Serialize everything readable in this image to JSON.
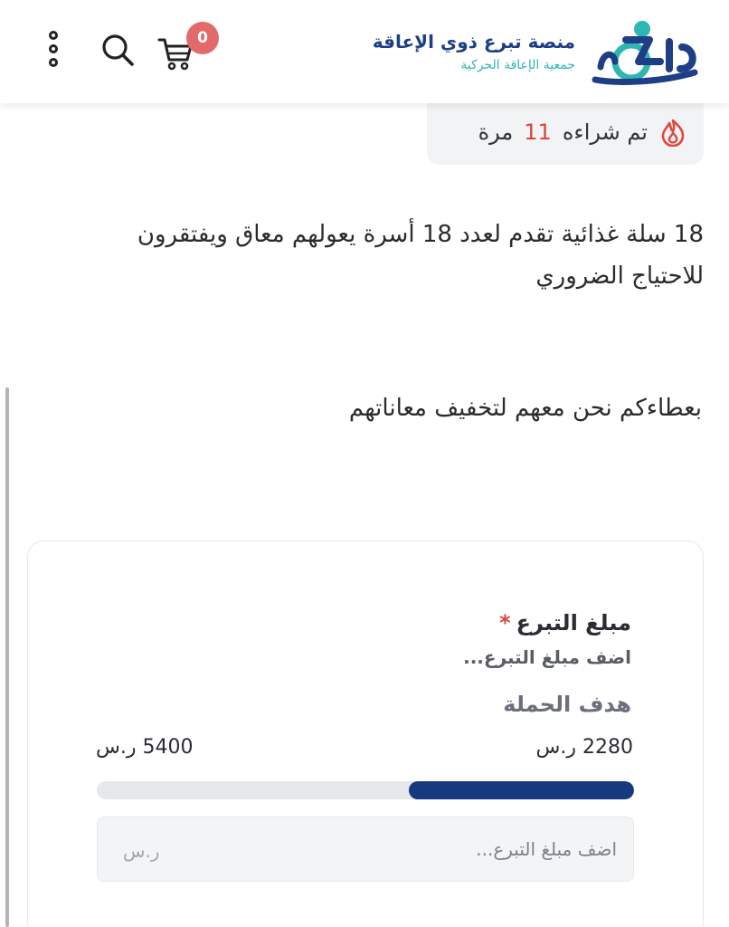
{
  "header": {
    "cart_count": "0",
    "logo_title": "منصة تبرع ذوي الإعاقة",
    "logo_subtitle": "جمعية الإعاقة الحركية",
    "logo_mark_text": "عازم",
    "brand_navy": "#1e3f86",
    "brand_teal": "#2eb6b0",
    "icons": [
      "menu-dots-icon",
      "search-icon",
      "cart-icon",
      "logo-icon"
    ]
  },
  "sold": {
    "prefix": "تم شراءه",
    "count": "11",
    "suffix": "مرة",
    "icon": "fire-icon",
    "accent": "#d9443f"
  },
  "description": {
    "text": "18 سلة غذائية تقدم لعدد 18 أسرة يعولهم معاق ويفتقرون للاحتياج الضروري",
    "slogan": "بعطاءكم نحن معهم لتخفيف معاناتهم"
  },
  "donation": {
    "label": "مبلغ التبرع",
    "required_mark": "*",
    "hint": "اضف مبلغ التبرع...",
    "goal_title": "هدف الحملة",
    "raised": "2280 ر.س",
    "goal": "5400 ر.س",
    "progress_fraction": 0.42,
    "progress_color": "#17397d",
    "input_placeholder": "اضف مبلغ التبرع...",
    "input_value": "",
    "currency": "ر.س"
  }
}
